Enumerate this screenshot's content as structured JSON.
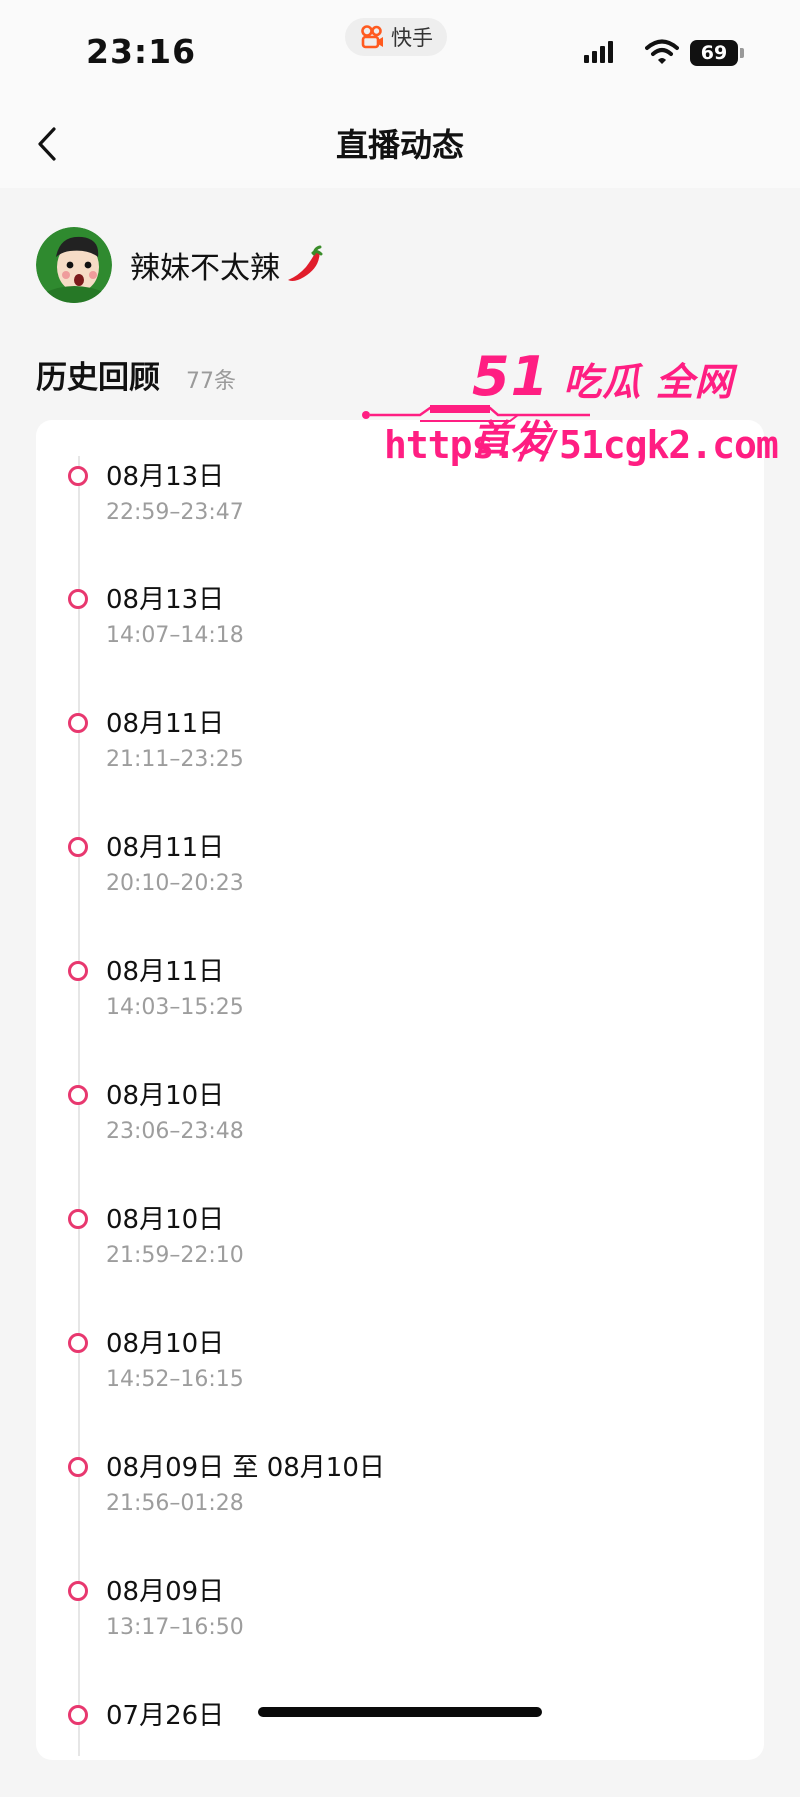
{
  "status_bar": {
    "time": "23:16",
    "app_name": "快手",
    "battery": "69",
    "icons": [
      "kuaishou-logo-icon",
      "signal-icon",
      "wifi-icon",
      "battery-icon"
    ]
  },
  "nav": {
    "title": "直播动态",
    "back_icon": "chevron-left-icon"
  },
  "user": {
    "name": "辣妹不太辣",
    "emoji_icon": "chili-pepper-icon"
  },
  "section": {
    "title": "历史回顾",
    "count": "77条"
  },
  "watermark": {
    "brand_number": "51",
    "brand_text": "吃瓜 全网首发",
    "url": "https://51cgk2.com"
  },
  "timeline": [
    {
      "date": "08月13日",
      "time": "22:59–23:47"
    },
    {
      "date": "08月13日",
      "time": "14:07–14:18"
    },
    {
      "date": "08月11日",
      "time": "21:11–23:25"
    },
    {
      "date": "08月11日",
      "time": "20:10–20:23"
    },
    {
      "date": "08月11日",
      "time": "14:03–15:25"
    },
    {
      "date": "08月10日",
      "time": "23:06–23:48"
    },
    {
      "date": "08月10日",
      "time": "21:59–22:10"
    },
    {
      "date": "08月10日",
      "time": "14:52–16:15"
    },
    {
      "date": "08月09日 至 08月10日",
      "time": "21:56–01:28"
    },
    {
      "date": "08月09日",
      "time": "13:17–16:50"
    },
    {
      "date": "07月26日",
      "time": ""
    }
  ],
  "colors": {
    "accent": "#e8386f",
    "watermark": "#ff1e82",
    "background": "#f5f5f5"
  }
}
